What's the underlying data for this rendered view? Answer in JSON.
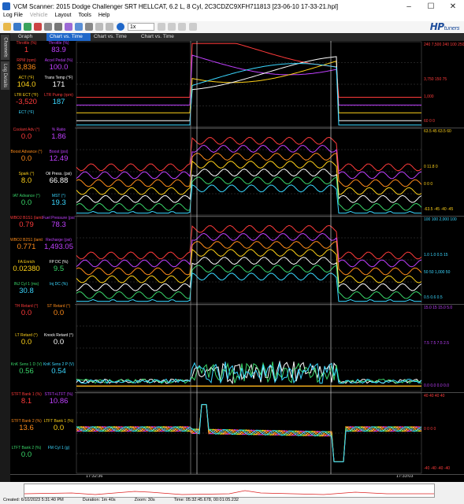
{
  "window": {
    "title": "VCM Scanner: 2015 Dodge Challenger SRT HELLCAT, 6.2 L, 8 Cyl, 2C3CDZC9XFH711813 [23-06-10 17-33-21.hpl]"
  },
  "menu": [
    "Log File",
    "Vehicle",
    "Layout",
    "Tools",
    "Help"
  ],
  "toolbar": {
    "speed": "1x"
  },
  "logo": {
    "brand": "HP",
    "sub": "tuners"
  },
  "sidetabs": [
    "Channels",
    "Log Details"
  ],
  "tabs": [
    "Graph",
    "Chart vs. Time",
    "Chart vs. Time",
    "Chart vs. Time"
  ],
  "panes": [
    {
      "labels": [
        {
          "name": "Throttle (%)",
          "color": "#ff3b3b"
        },
        {
          "name": "Throttle (%)",
          "color": "#c040ff"
        },
        {
          "name": "RPM (rpm)",
          "color": "#ff3b3b"
        },
        {
          "name": "Accel Pedal (%)",
          "color": "#c040ff"
        },
        {
          "name": "ACT (°F)",
          "color": "#ffd21a"
        },
        {
          "name": "Trans Temp (°F)",
          "color": "#ffffff"
        },
        {
          "name": "LTR ECT (°F)",
          "color": "#ffd21a"
        },
        {
          "name": "LTR Pump (rpm)",
          "color": "#ff3b3b"
        },
        {
          "name": "ECT (°F)",
          "color": "#3ad7ff"
        }
      ],
      "values": [
        {
          "v": "1",
          "color": "#ff3b3b"
        },
        {
          "v": "83.9",
          "color": "#c040ff"
        },
        {
          "v": "3,836",
          "color": "#ff8c1a"
        },
        {
          "v": "100.0",
          "color": "#c040ff"
        },
        {
          "v": "104.0",
          "color": "#ffd21a"
        },
        {
          "v": "171",
          "color": "#ffffff"
        },
        {
          "v": "-3,520",
          "color": "#ff3b3b"
        },
        {
          "v": "187",
          "color": "#3ad7ff"
        }
      ],
      "scale": {
        "top": "240  7,500  240  100  250",
        "mid": "3,750  150  75",
        "low": "1,000",
        "bot": "60  0  0"
      }
    },
    {
      "labels": [
        {
          "name": "Coolant Adv (°)",
          "color": "#ff3b3b"
        },
        {
          "name": "% Ratio",
          "color": "#c040ff"
        },
        {
          "name": "Boost Advance (°)",
          "color": "#ff8c1a"
        },
        {
          "name": "Boost (psi)",
          "color": "#c040ff"
        },
        {
          "name": "Spark (°)",
          "color": "#ffd21a"
        },
        {
          "name": "Oil Press. (psi)",
          "color": "#ffffff"
        },
        {
          "name": "IAT Advance (°)",
          "color": "#3ad76a"
        },
        {
          "name": "MST (°)",
          "color": "#3ad7ff"
        }
      ],
      "values": [
        {
          "v": "0.0",
          "color": "#ff3b3b"
        },
        {
          "v": "1.86",
          "color": "#c040ff"
        },
        {
          "v": "0.0",
          "color": "#ff8c1a"
        },
        {
          "v": "12.49",
          "color": "#c040ff"
        },
        {
          "v": "8.0",
          "color": "#ffd21a"
        },
        {
          "v": "66.88",
          "color": "#ffffff"
        },
        {
          "v": "0.0",
          "color": "#3ad76a"
        },
        {
          "v": "19.3",
          "color": "#3ad7ff"
        }
      ],
      "scale": {
        "top": "63.5  45  63.5  60",
        "mid": "0  11.8  0",
        "low": "0  0  0",
        "bot": "-63.5  -45  -40  -45"
      }
    },
    {
      "labels": [
        {
          "name": "WBO2 B1S1 (lambda)",
          "color": "#ff3b3b"
        },
        {
          "name": "Fuel Pressure (psi)",
          "color": "#c040ff"
        },
        {
          "name": "WBO2 B2S1 (lambda)",
          "color": "#ff8c1a"
        },
        {
          "name": "Recharge (psi)",
          "color": "#c040ff"
        },
        {
          "name": "FA Enrich",
          "color": "#ffd21a"
        },
        {
          "name": "FP DC (%)",
          "color": "#ffffff"
        },
        {
          "name": "INJ Cyl 1 (ms)",
          "color": "#3ad76a"
        },
        {
          "name": "Inj DC (%)",
          "color": "#3ad7ff"
        }
      ],
      "values": [
        {
          "v": "0.79",
          "color": "#ff3b3b"
        },
        {
          "v": "78.3",
          "color": "#c040ff"
        },
        {
          "v": "0.771",
          "color": "#ff8c1a"
        },
        {
          "v": "1,493.05",
          "color": "#c040ff"
        },
        {
          "v": "0.02380",
          "color": "#ffd21a"
        },
        {
          "v": "9.5",
          "color": "#3ad76a"
        },
        {
          "v": "30.8",
          "color": "#3ad7ff"
        }
      ],
      "scale": {
        "top": "100  100  2,000  100",
        "mid": "1.0  1.0  0.5  15",
        "low": "50  50  1,000  50",
        "bot": "0.5  0.6  0.5"
      }
    },
    {
      "labels": [
        {
          "name": "TH Retard (°)",
          "color": "#ff3b3b"
        },
        {
          "name": "ST Retard (°)",
          "color": "#ff8c1a"
        },
        {
          "name": "LT Retard (°)",
          "color": "#ffd21a"
        },
        {
          "name": "Knock Retard (°)",
          "color": "#ffffff"
        },
        {
          "name": "KnK Sens 1 D (V)",
          "color": "#3ad76a"
        },
        {
          "name": "KnK Sens 2 P (V)",
          "color": "#3ad7ff"
        }
      ],
      "values": [
        {
          "v": "0.0",
          "color": "#ff3b3b"
        },
        {
          "v": "0.0",
          "color": "#ff8c1a"
        },
        {
          "v": "0.0",
          "color": "#ffd21a"
        },
        {
          "v": "0.0",
          "color": "#ffffff"
        },
        {
          "v": "0.56",
          "color": "#3ad76a"
        },
        {
          "v": "0.54",
          "color": "#3ad7ff"
        }
      ],
      "scale": {
        "top": "15.0  15  15.0  5.0",
        "mid": "7.5  7.5  7.5  2.5",
        "low": "",
        "bot": "0.0  0.0  0.0  0.0"
      }
    },
    {
      "labels": [
        {
          "name": "STFT Bank 1 (%)",
          "color": "#ff3b3b"
        },
        {
          "name": "STFT+LTFT (%)",
          "color": "#c040ff"
        },
        {
          "name": "STFT Bank 2 (%)",
          "color": "#ff8c1a"
        },
        {
          "name": "LTFT Bank 1 (%)",
          "color": "#ffd21a"
        },
        {
          "name": "LTFT Bank 2 (%)",
          "color": "#3ad76a"
        },
        {
          "name": "FM Cyl 1 (g)",
          "color": "#3ad7ff"
        }
      ],
      "values": [
        {
          "v": "8.1",
          "color": "#ff3b3b"
        },
        {
          "v": "10.86",
          "color": "#c040ff"
        },
        {
          "v": "13.6",
          "color": "#ff8c1a"
        },
        {
          "v": "0.0",
          "color": "#ffd21a"
        },
        {
          "v": "0.0",
          "color": "#3ad76a"
        }
      ],
      "scale": {
        "top": "40  40  40  40",
        "mid": "0  0  0  0",
        "low": "",
        "bot": "-40  -40  -40  -40"
      }
    }
  ],
  "time_axis": {
    "start": "17:32:36",
    "end": "17:33:03"
  },
  "status": {
    "created": "Created: 6/10/2023 5:31:40 PM",
    "duration": "Duration: 1m 40s",
    "zoom": "Zoom: 30s",
    "time": "Time: 05:32:45.678, 00:01:05.232"
  }
}
